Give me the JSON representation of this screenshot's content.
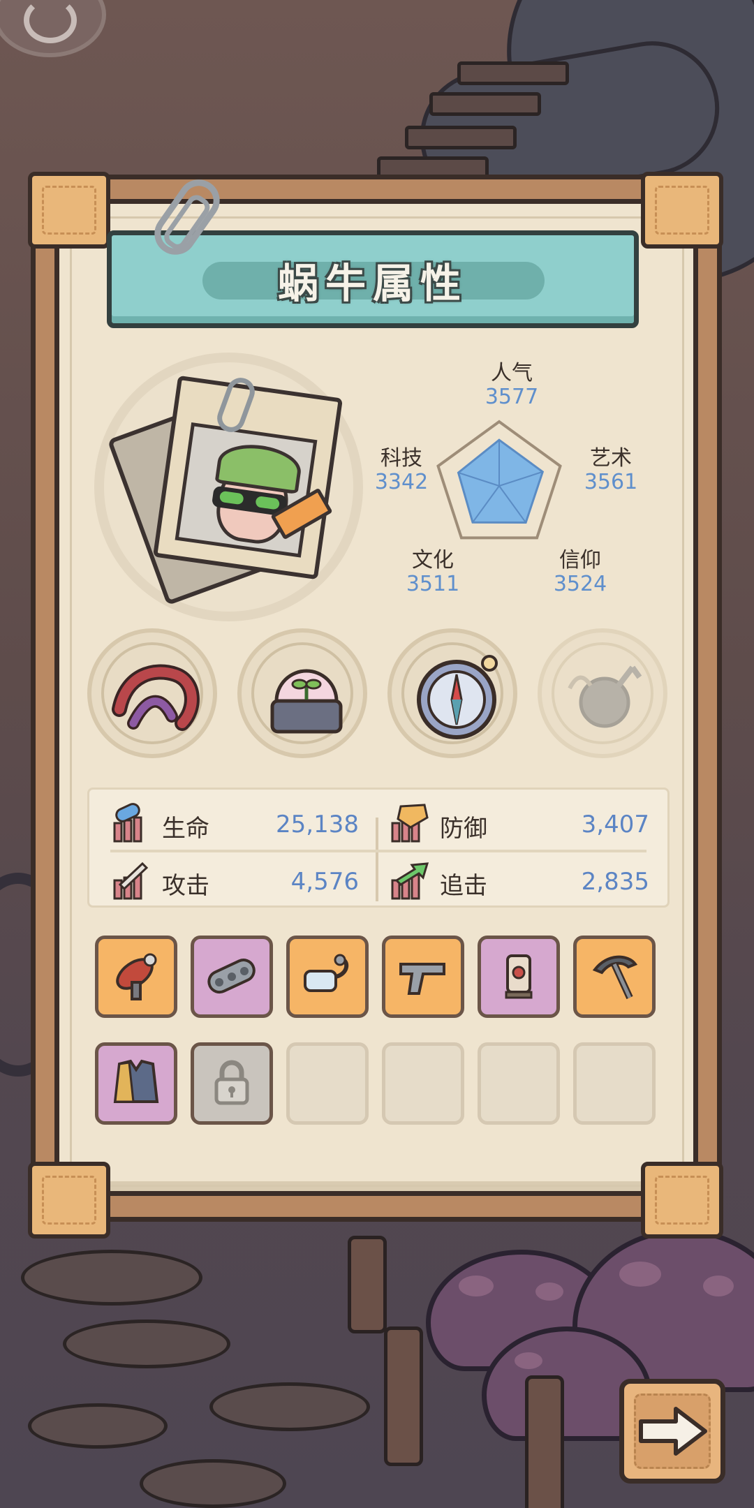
{
  "panel": {
    "title": "蜗牛属性"
  },
  "radar": {
    "stats": [
      {
        "key": "popularity",
        "label": "人气",
        "value": "3577",
        "raw": 3577
      },
      {
        "key": "art",
        "label": "艺术",
        "value": "3561",
        "raw": 3561
      },
      {
        "key": "faith",
        "label": "信仰",
        "value": "3524",
        "raw": 3524
      },
      {
        "key": "culture",
        "label": "文化",
        "value": "3511",
        "raw": 3511
      },
      {
        "key": "tech",
        "label": "科技",
        "value": "3342",
        "raw": 3342
      }
    ]
  },
  "skills": [
    {
      "name": "tentacle-relic-icon",
      "state": "active"
    },
    {
      "name": "sprout-dome-icon",
      "state": "active"
    },
    {
      "name": "compass-icon",
      "state": "active"
    },
    {
      "name": "chained-bomb-icon",
      "state": "faded"
    }
  ],
  "stats": {
    "hp": {
      "label": "生命",
      "value": "25,138"
    },
    "defense": {
      "label": "防御",
      "value": "3,407"
    },
    "attack": {
      "label": "攻击",
      "value": "4,576"
    },
    "chase": {
      "label": "追击",
      "value": "2,835"
    }
  },
  "equipment": [
    {
      "icon": "ray-gun-icon",
      "rarity": "orange"
    },
    {
      "icon": "tank-tread-icon",
      "rarity": "purple"
    },
    {
      "icon": "goggles-icon",
      "rarity": "orange"
    },
    {
      "icon": "pistol-icon",
      "rarity": "orange"
    },
    {
      "icon": "lantern-icon",
      "rarity": "purple"
    },
    {
      "icon": "pickaxe-icon",
      "rarity": "orange"
    },
    {
      "icon": "vest-icon",
      "rarity": "purple"
    },
    {
      "icon": "lock-icon",
      "rarity": "locked"
    },
    {
      "icon": "",
      "rarity": "empty"
    },
    {
      "icon": "",
      "rarity": "empty"
    },
    {
      "icon": "",
      "rarity": "empty"
    },
    {
      "icon": "",
      "rarity": "empty"
    }
  ],
  "colors": {
    "orange": "#f6b566",
    "purple": "#d6a8cf",
    "value_blue": "#5b84c4",
    "radar_fill": "#7fb6e6"
  }
}
